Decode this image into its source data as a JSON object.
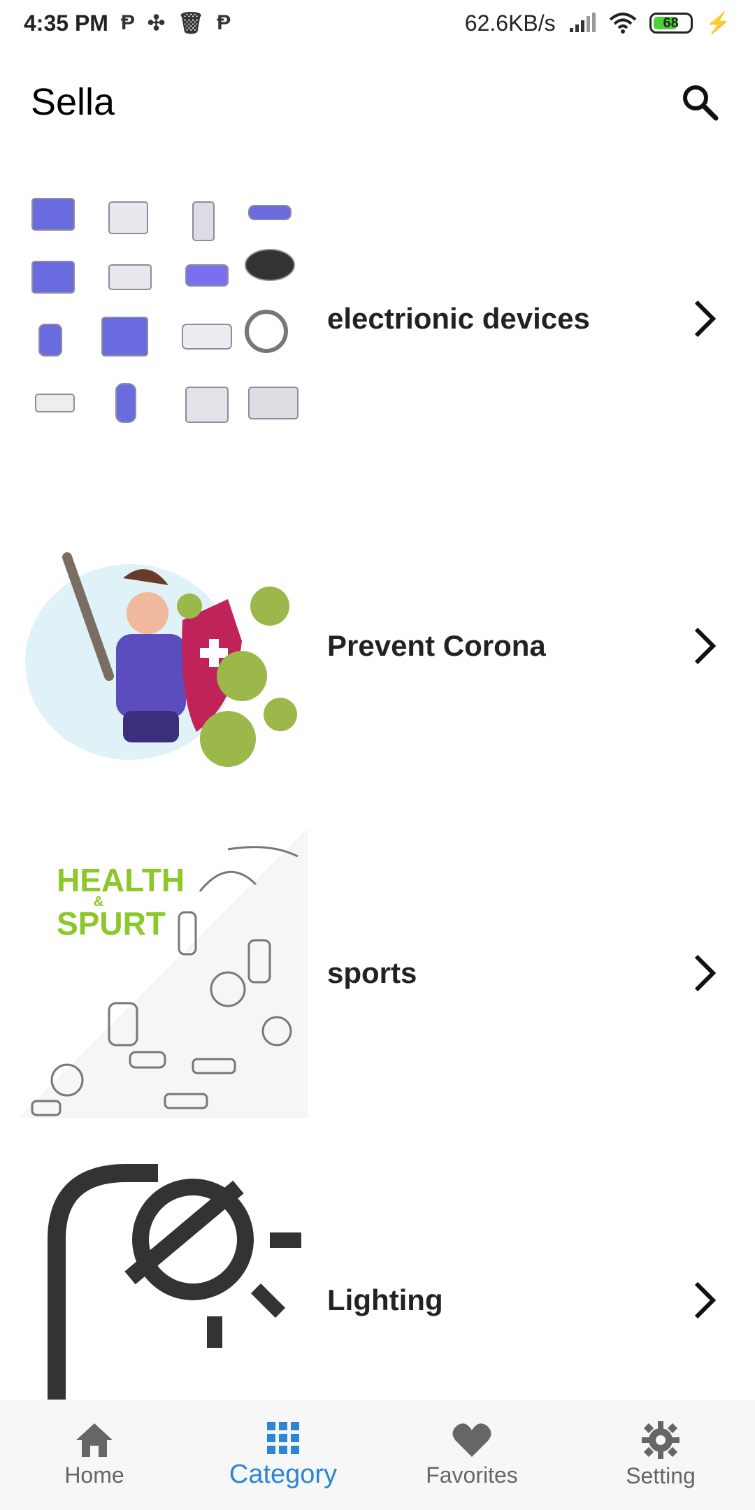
{
  "status_bar": {
    "time": "4:35 PM",
    "net_speed": "62.6KB/s",
    "battery_level": "68"
  },
  "app_bar": {
    "title": "Sella"
  },
  "categories": [
    {
      "label": "electrionic devices"
    },
    {
      "label": "Prevent Corona"
    },
    {
      "label": "sports"
    },
    {
      "label": "Lighting"
    }
  ],
  "health_logo": {
    "line1": "HEALTH",
    "amp": "&",
    "line2": "SPURT"
  },
  "bottom_nav": {
    "items": [
      {
        "label": "Home"
      },
      {
        "label": "Category"
      },
      {
        "label": "Favorites"
      },
      {
        "label": "Setting"
      }
    ],
    "active_color": "#2b86d6",
    "inactive_color": "#666666"
  }
}
